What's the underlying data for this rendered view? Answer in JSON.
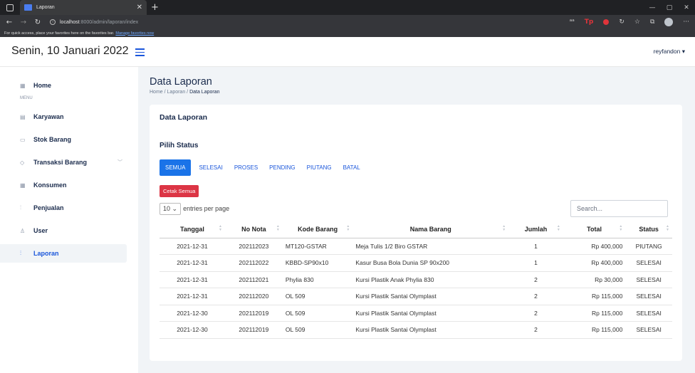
{
  "browser": {
    "tab_title": "Laporan",
    "url_host": "localhost",
    "url_path": ":8000/admin/laporan/index",
    "favorites_text": "For quick access, place your favorites here on the favorites bar.",
    "favorites_link": "Manage favorites now"
  },
  "header": {
    "date": "Senin, 10 Januari 2022",
    "user": "reyfandon ▾"
  },
  "sidebar": {
    "menu_label": "MENU",
    "items": [
      {
        "label": "Home",
        "icon": "grid-icon"
      },
      {
        "label": "Karyawan",
        "icon": "document-icon"
      },
      {
        "label": "Stok Barang",
        "icon": "list-icon"
      },
      {
        "label": "Transaksi Barang",
        "icon": "gem-icon"
      },
      {
        "label": "Konsumen",
        "icon": "table-icon"
      },
      {
        "label": "Penjualan",
        "icon": "bar-chart-icon"
      },
      {
        "label": "User",
        "icon": "user-icon"
      },
      {
        "label": "Laporan",
        "icon": "bar-chart-icon"
      }
    ]
  },
  "page": {
    "title": "Data Laporan",
    "breadcrumb": [
      "Home",
      "Laporan",
      "Data Laporan"
    ],
    "card_title": "Data Laporan",
    "section_title": "Pilih Status",
    "status_tabs": [
      "SEMUA",
      "SELESAI",
      "PROSES",
      "PENDING",
      "PIUTANG",
      "BATAL"
    ],
    "print_button": "Cetak Semua",
    "entries_value": "10",
    "entries_label": "entries per page",
    "search_placeholder": "Search..."
  },
  "table": {
    "columns": [
      "Tanggal",
      "No Nota",
      "Kode Barang",
      "Nama Barang",
      "Jumlah",
      "Total",
      "Status"
    ],
    "rows": [
      [
        "2021-12-31",
        "202112023",
        "MT120-GSTAR",
        "Meja Tulis 1/2 Biro GSTAR",
        "1",
        "Rp 400,000",
        "PIUTANG"
      ],
      [
        "2021-12-31",
        "202112022",
        "KBBD-SP90x10",
        "Kasur Busa Bola Dunia SP 90x200",
        "1",
        "Rp 400,000",
        "SELESAI"
      ],
      [
        "2021-12-31",
        "202112021",
        "Phylia 830",
        "Kursi Plastik Anak Phylia 830",
        "2",
        "Rp 30,000",
        "SELESAI"
      ],
      [
        "2021-12-31",
        "202112020",
        "OL 509",
        "Kursi Plastik Santai Olymplast",
        "2",
        "Rp 115,000",
        "SELESAI"
      ],
      [
        "2021-12-30",
        "202112019",
        "OL 509",
        "Kursi Plastik Santai Olymplast",
        "2",
        "Rp 115,000",
        "SELESAI"
      ],
      [
        "2021-12-30",
        "202112019",
        "OL 509",
        "Kursi Plastik Santai Olymplast",
        "2",
        "Rp 115,000",
        "SELESAI"
      ]
    ]
  },
  "colors": {
    "accent": "#1a73e8",
    "danger": "#dc3545",
    "navy": "#1a2b4c"
  }
}
